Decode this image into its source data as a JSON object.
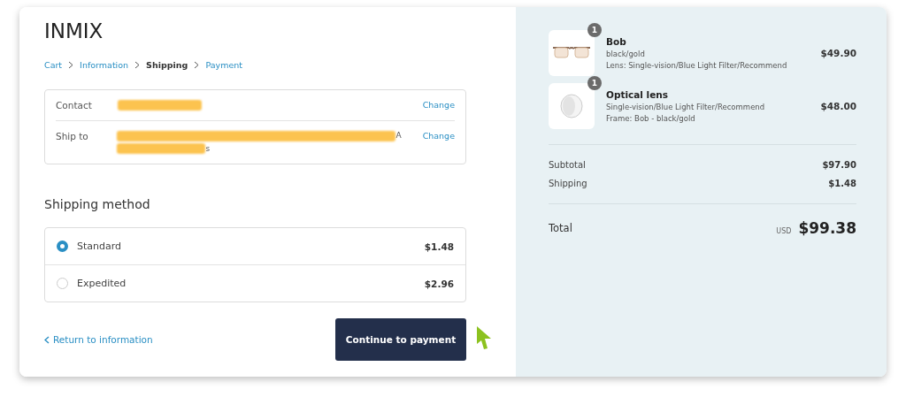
{
  "brand": "INMIX",
  "breadcrumb": [
    {
      "label": "Cart",
      "selected": false
    },
    {
      "label": "Information",
      "selected": false
    },
    {
      "label": "Shipping",
      "selected": true
    },
    {
      "label": "Payment",
      "selected": false
    }
  ],
  "review": [
    {
      "label": "Contact",
      "action": "Change"
    },
    {
      "label": "Ship to",
      "value_tail": "A",
      "value_tail_2": "s",
      "action": "Change"
    }
  ],
  "shipping_method": {
    "title": "Shipping method",
    "options": [
      {
        "label": "Standard",
        "price": "$1.48",
        "selected": true
      },
      {
        "label": "Expedited",
        "price": "$2.96",
        "selected": false
      }
    ]
  },
  "back_link": "Return to information",
  "continue_button": "Continue to payment",
  "order": {
    "items": [
      {
        "kind": "glasses",
        "quantity": "1",
        "name": "Bob",
        "lines": [
          "black/gold",
          "Lens: Single-vision/Blue Light Filter/Recommend"
        ],
        "price": "$49.90"
      },
      {
        "kind": "lens",
        "quantity": "1",
        "name": "Optical lens",
        "lines": [
          "Single-vision/Blue Light Filter/Recommend",
          "Frame: Bob - black/gold"
        ],
        "price": "$48.00"
      }
    ],
    "summary": [
      {
        "label": "Subtotal",
        "value": "$97.90"
      },
      {
        "label": "Shipping",
        "value": "$1.48"
      }
    ],
    "total": {
      "label": "Total",
      "currency": "USD",
      "value": "$99.38"
    }
  }
}
